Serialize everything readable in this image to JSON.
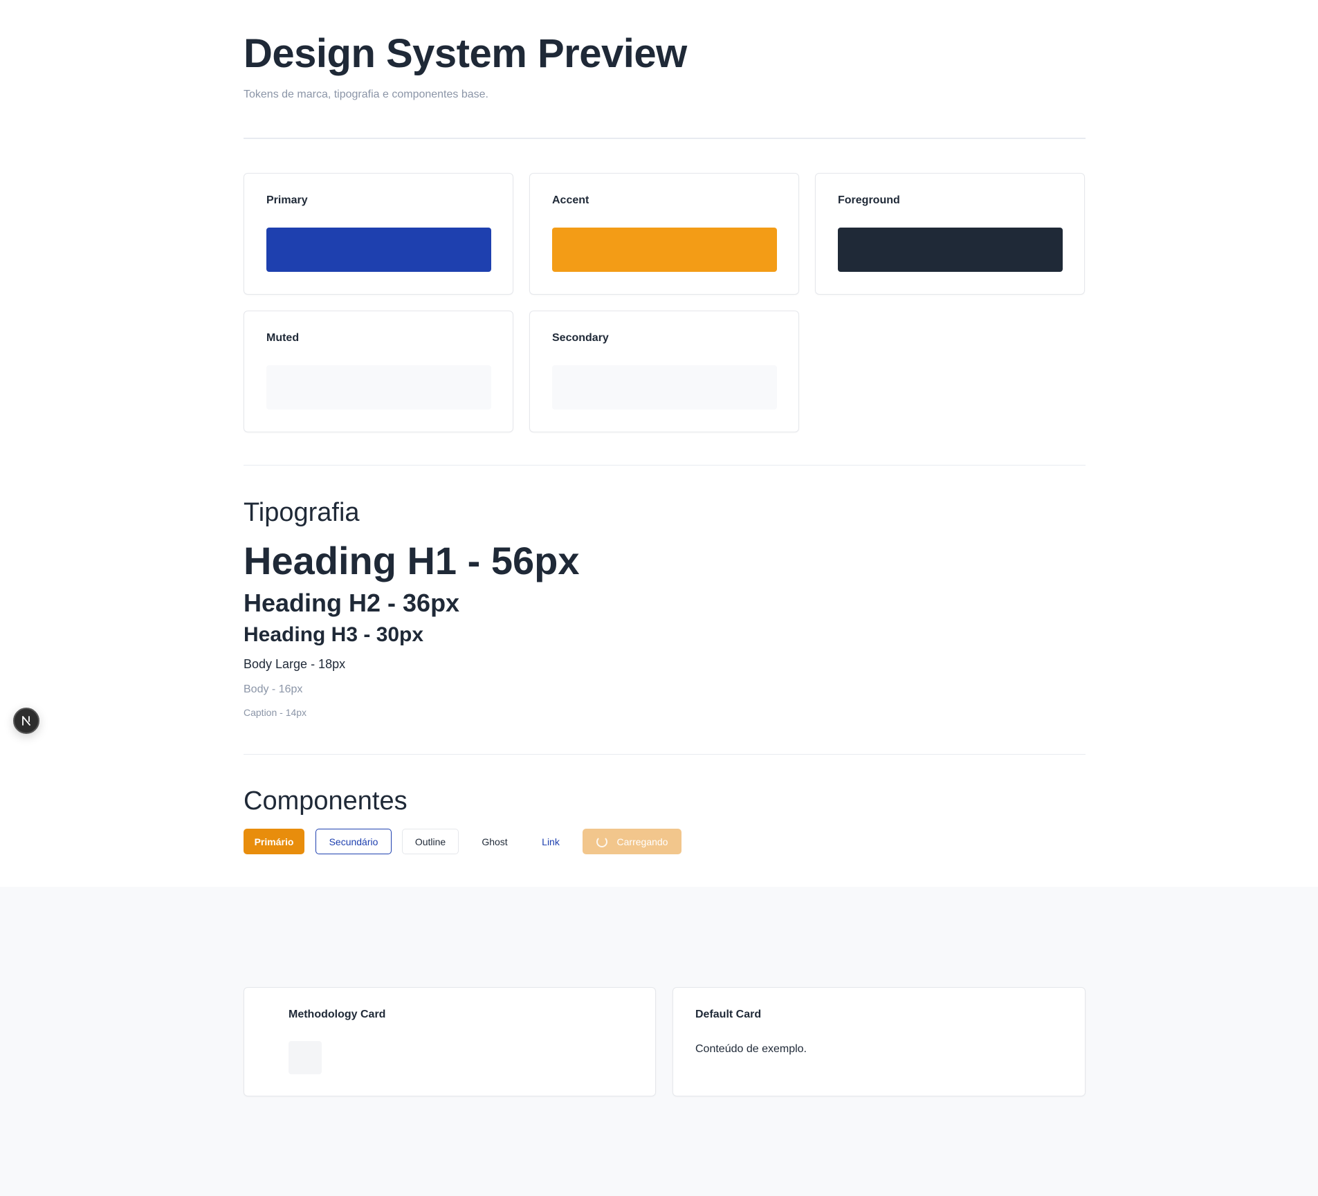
{
  "header": {
    "title": "Design System Preview",
    "subtitle": "Tokens de marca, tipografia e componentes base."
  },
  "colors": [
    {
      "label": "Primary",
      "hex": "#1e40af"
    },
    {
      "label": "Accent",
      "hex": "#f39c16"
    },
    {
      "label": "Foreground",
      "hex": "#1f2937"
    },
    {
      "label": "Muted",
      "hex": "#f8f9fb"
    },
    {
      "label": "Secondary",
      "hex": "#f8f9fb"
    }
  ],
  "typography": {
    "section_title": "Tipografia",
    "h1": "Heading H1 - 56px",
    "h2": "Heading H2 - 36px",
    "h3": "Heading H3 - 30px",
    "body_large": "Body Large - 18px",
    "body": "Body - 16px",
    "caption": "Caption - 14px"
  },
  "components": {
    "section_title": "Componentes",
    "buttons": {
      "primary": "Primário",
      "secondary": "Secundário",
      "outline": "Outline",
      "ghost": "Ghost",
      "link": "Link",
      "loading": "Carregando"
    }
  },
  "cards": {
    "methodology_title": "Methodology Card",
    "default_title": "Default Card",
    "default_body": "Conteúdo de exemplo."
  },
  "badge": {
    "letter": "N",
    "icon": "nextjs-icon"
  }
}
